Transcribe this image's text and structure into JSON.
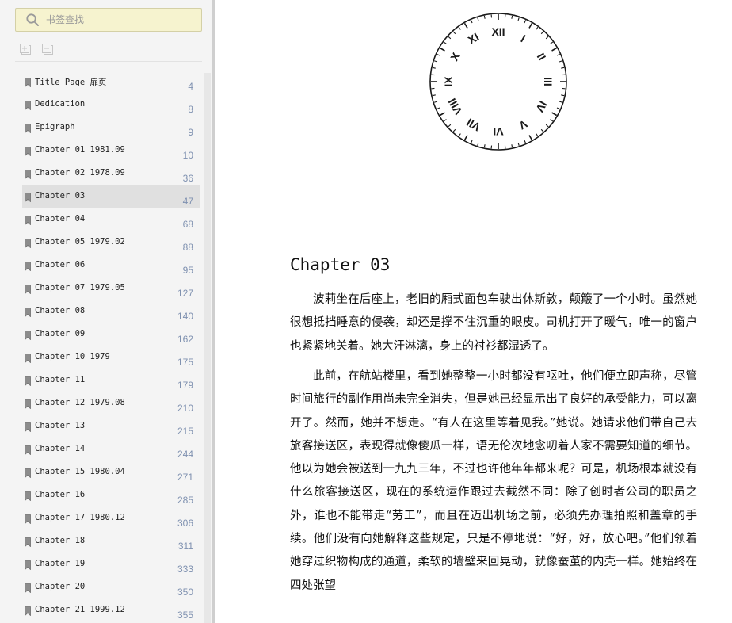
{
  "search": {
    "placeholder": "书签查找"
  },
  "toolbar": {
    "expand_icon": "expand-all-icon",
    "collapse_icon": "collapse-all-icon"
  },
  "toc": {
    "active_index": 5,
    "items": [
      {
        "label": "Title Page 扉页",
        "page": "4"
      },
      {
        "label": "Dedication",
        "page": "8"
      },
      {
        "label": "Epigraph",
        "page": "9"
      },
      {
        "label": "Chapter 01 1981.09",
        "page": "10"
      },
      {
        "label": "Chapter 02 1978.09",
        "page": "36"
      },
      {
        "label": "Chapter 03",
        "page": "47"
      },
      {
        "label": "Chapter 04",
        "page": "68"
      },
      {
        "label": "Chapter 05 1979.02",
        "page": "88"
      },
      {
        "label": "Chapter 06",
        "page": "95"
      },
      {
        "label": "Chapter 07 1979.05",
        "page": "127"
      },
      {
        "label": "Chapter 08",
        "page": "140"
      },
      {
        "label": "Chapter 09",
        "page": "162"
      },
      {
        "label": "Chapter 10 1979",
        "page": "175"
      },
      {
        "label": "Chapter 11",
        "page": "179"
      },
      {
        "label": "Chapter 12 1979.08",
        "page": "210"
      },
      {
        "label": "Chapter 13",
        "page": "215"
      },
      {
        "label": "Chapter 14",
        "page": "244"
      },
      {
        "label": "Chapter 15 1980.04",
        "page": "271"
      },
      {
        "label": "Chapter 16",
        "page": "285"
      },
      {
        "label": "Chapter 17 1980.12",
        "page": "306"
      },
      {
        "label": "Chapter 18",
        "page": "311"
      },
      {
        "label": "Chapter 19",
        "page": "333"
      },
      {
        "label": "Chapter 20",
        "page": "350"
      },
      {
        "label": "Chapter 21 1999.12",
        "page": "355"
      }
    ]
  },
  "clock": {
    "numerals": [
      "XII",
      "I",
      "II",
      "III",
      "IV",
      "V",
      "VI",
      "VII",
      "VIII",
      "IX",
      "X",
      "XI"
    ]
  },
  "content": {
    "chapter_title": "Chapter 03",
    "paragraphs": [
      "波莉坐在后座上，老旧的厢式面包车驶出休斯敦，颠簸了一个小时。虽然她很想抵挡睡意的侵袭，却还是撑不住沉重的眼皮。司机打开了暖气，唯一的窗户也紧紧地关着。她大汗淋漓，身上的衬衫都湿透了。",
      "此前，在航站楼里，看到她整整一小时都没有呕吐，他们便立即声称，尽管时间旅行的副作用尚未完全消失，但是她已经显示出了良好的承受能力，可以离开了。然而，她并不想走。“有人在这里等着见我。”她说。她请求他们带自己去旅客接送区，表现得就像傻瓜一样，语无伦次地念叨着人家不需要知道的细节。他以为她会被送到一九九三年，不过也许他年年都来呢？可是，机场根本就没有什么旅客接送区，现在的系统运作跟过去截然不同：除了创时者公司的职员之外，谁也不能带走“劳工”，而且在迈出机场之前，必须先办理拍照和盖章的手续。他们没有向她解释这些规定，只是不停地说：“好，好，放心吧。”他们领着她穿过织物构成的通道，柔软的墙壁来回晃动，就像蚕茧的内壳一样。她始终在四处张望"
    ]
  },
  "colors": {
    "search_bg": "#f6f3cf",
    "active_row": "#e0e0e0",
    "page_number": "#7f91b0",
    "sidebar_bg": "#f4f4f4"
  }
}
